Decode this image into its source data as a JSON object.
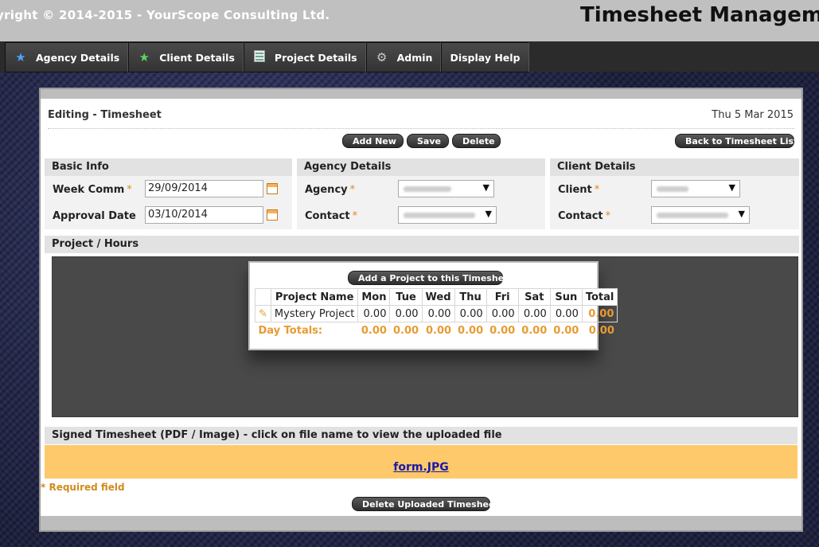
{
  "header": {
    "copyright": "yright © 2014-2015 - YourScope Consulting Ltd.",
    "app_title": "Timesheet Managemer"
  },
  "nav": {
    "items": [
      {
        "label": "Agency Details",
        "icon": "blue-star-icon"
      },
      {
        "label": "Client Details",
        "icon": "green-star-icon"
      },
      {
        "label": "Project Details",
        "icon": "spreadsheet-icon"
      },
      {
        "label": "Admin",
        "icon": "gears-icon"
      },
      {
        "label": "Display Help",
        "icon": ""
      }
    ]
  },
  "page": {
    "title": "Editing - Timesheet",
    "date": "Thu 5 Mar 2015"
  },
  "toolbar": {
    "add_new": "Add New",
    "save": "Save",
    "delete": "Delete",
    "back": "Back to Timesheet List"
  },
  "basic_info": {
    "heading": "Basic Info",
    "week_comm_label": "Week Comm",
    "week_comm_value": "29/09/2014",
    "approval_label": "Approval Date",
    "approval_value": "03/10/2014",
    "required_mark": "*"
  },
  "agency": {
    "heading": "Agency Details",
    "agency_label": "Agency",
    "contact_label": "Contact"
  },
  "client": {
    "heading": "Client Details",
    "client_label": "Client",
    "contact_label": "Contact"
  },
  "project_hours": {
    "heading": "Project / Hours",
    "add_button": "Add a Project to this Timesheet",
    "columns": [
      "Project Name",
      "Mon",
      "Tue",
      "Wed",
      "Thu",
      "Fri",
      "Sat",
      "Sun",
      "Total"
    ],
    "row": {
      "name": "Mystery Project",
      "values": [
        "0.00",
        "0.00",
        "0.00",
        "0.00",
        "0.00",
        "0.00",
        "0.00"
      ],
      "total": "0.00"
    },
    "totals": {
      "label": "Day Totals:",
      "values": [
        "0.00",
        "0.00",
        "0.00",
        "0.00",
        "0.00",
        "0.00",
        "0.00"
      ],
      "total": "0.00"
    }
  },
  "signed": {
    "heading": "Signed Timesheet (PDF / Image) - click on file name to view the uploaded file",
    "file": "form.JPG",
    "required_note": "* Required field",
    "delete_button": "Delete Uploaded Timesheet"
  },
  "colors": {
    "accent_orange": "#e89b32",
    "file_box": "#fdc96a",
    "nav_bg": "#2b2b2b"
  }
}
